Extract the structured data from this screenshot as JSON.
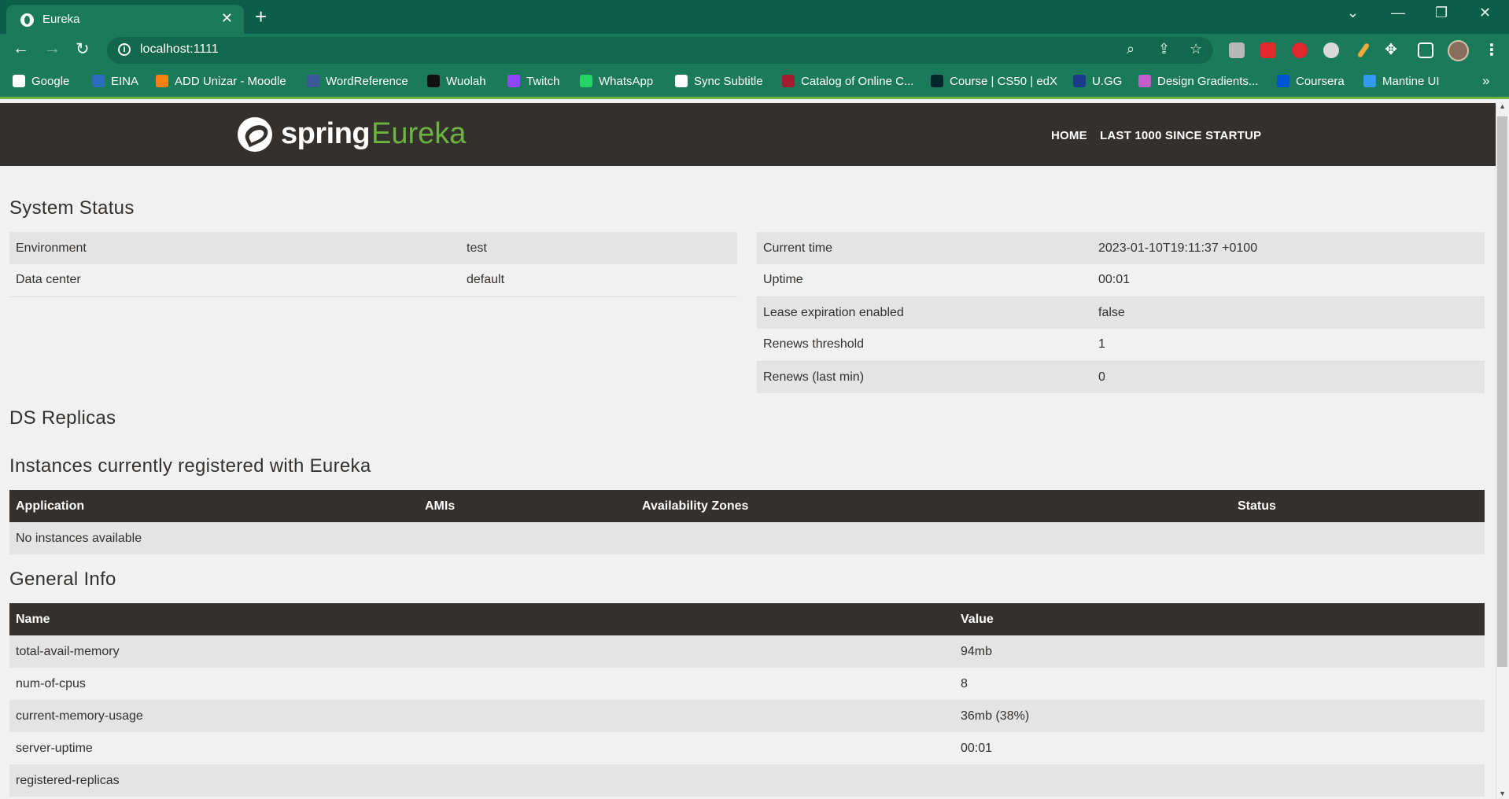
{
  "browser": {
    "tab_title": "Eureka",
    "url": "localhost:1111",
    "bookmarks": [
      {
        "label": "Google",
        "icon": "google-icon",
        "color": "#ffffff"
      },
      {
        "label": "EINA",
        "icon": "eina-icon",
        "color": "#2a6dbf"
      },
      {
        "label": "ADD Unizar - Moodle",
        "icon": "moodle-icon",
        "color": "#f98012"
      },
      {
        "label": "WordReference",
        "icon": "wordreference-icon",
        "color": "#3b5998"
      },
      {
        "label": "Wuolah",
        "icon": "wuolah-icon",
        "color": "#111111"
      },
      {
        "label": "Twitch",
        "icon": "twitch-icon",
        "color": "#9146ff"
      },
      {
        "label": "WhatsApp",
        "icon": "whatsapp-icon",
        "color": "#25d366"
      },
      {
        "label": "Sync Subtitle",
        "icon": "globe-icon",
        "color": "#ffffff"
      },
      {
        "label": "Catalog of Online C...",
        "icon": "harvard-icon",
        "color": "#a51c30"
      },
      {
        "label": "Course | CS50 | edX",
        "icon": "edx-icon",
        "color": "#02262b"
      },
      {
        "label": "U.GG",
        "icon": "ugg-icon",
        "color": "#1a3a8a"
      },
      {
        "label": "Design Gradients...",
        "icon": "gradients-icon",
        "color": "#c45cc9"
      },
      {
        "label": "Coursera",
        "icon": "coursera-icon",
        "color": "#0056d2"
      },
      {
        "label": "Mantine UI",
        "icon": "mantine-icon",
        "color": "#339af0"
      }
    ]
  },
  "header": {
    "logo_spring": "spring",
    "logo_eureka": "Eureka",
    "nav": [
      "HOME",
      "LAST 1000 SINCE STARTUP"
    ]
  },
  "system_status": {
    "title": "System Status",
    "left": [
      {
        "key": "Environment",
        "value": "test"
      },
      {
        "key": "Data center",
        "value": "default"
      }
    ],
    "right": [
      {
        "key": "Current time",
        "value": "2023-01-10T19:11:37 +0100"
      },
      {
        "key": "Uptime",
        "value": "00:01"
      },
      {
        "key": "Lease expiration enabled",
        "value": "false"
      },
      {
        "key": "Renews threshold",
        "value": "1"
      },
      {
        "key": "Renews (last min)",
        "value": "0"
      }
    ]
  },
  "ds_replicas": {
    "title": "DS Replicas"
  },
  "instances": {
    "title": "Instances currently registered with Eureka",
    "columns": [
      "Application",
      "AMIs",
      "Availability Zones",
      "Status"
    ],
    "empty_message": "No instances available"
  },
  "general_info": {
    "title": "General Info",
    "columns": [
      "Name",
      "Value"
    ],
    "rows": [
      {
        "name": "total-avail-memory",
        "value": "94mb"
      },
      {
        "name": "num-of-cpus",
        "value": "8"
      },
      {
        "name": "current-memory-usage",
        "value": "36mb (38%)"
      },
      {
        "name": "server-uptime",
        "value": "00:01"
      },
      {
        "name": "registered-replicas",
        "value": ""
      }
    ]
  }
}
